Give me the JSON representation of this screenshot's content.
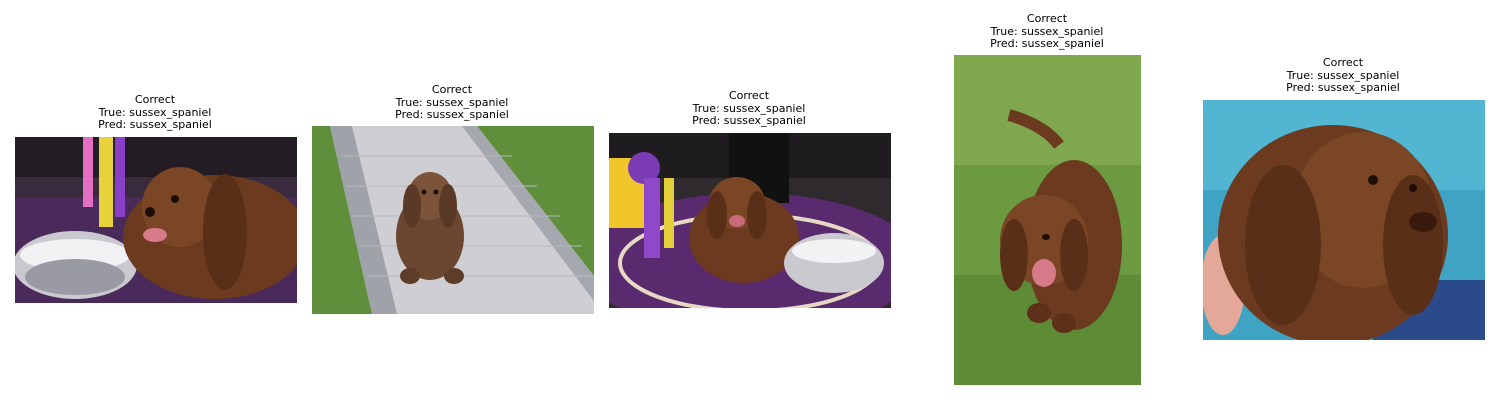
{
  "panels": [
    {
      "status": "Correct",
      "true_label": "True: sussex_spaniel",
      "pred_label": "Pred: sussex_spaniel"
    },
    {
      "status": "Correct",
      "true_label": "True: sussex_spaniel",
      "pred_label": "Pred: sussex_spaniel"
    },
    {
      "status": "Correct",
      "true_label": "True: sussex_spaniel",
      "pred_label": "Pred: sussex_spaniel"
    },
    {
      "status": "Correct",
      "true_label": "True: sussex_spaniel",
      "pred_label": "Pred: sussex_spaniel"
    },
    {
      "status": "Correct",
      "true_label": "True: sussex_spaniel",
      "pred_label": "Pred: sussex_spaniel"
    }
  ],
  "images": [
    {
      "subject": "sussex spaniel beside silver trophy bowl with ribbons"
    },
    {
      "subject": "sussex spaniel sitting on brick path beside grass"
    },
    {
      "subject": "sussex spaniel at show with rosette and silver bowl"
    },
    {
      "subject": "sussex spaniel walking on grass"
    },
    {
      "subject": "sussex spaniel close-up held by person in blue jacket"
    }
  ],
  "colors": {
    "dog_brown": "#6b3a1f",
    "grass": "#5f8f3a",
    "purple_carpet": "#5a2a6e"
  }
}
